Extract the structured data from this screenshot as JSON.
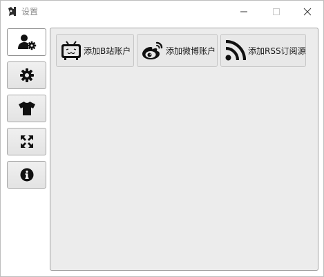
{
  "window": {
    "title": "设置",
    "controls": [
      "minimize-icon",
      "maximize-icon",
      "close-icon"
    ]
  },
  "sidebar": {
    "items": [
      {
        "icon": "user-gear-icon",
        "active": true
      },
      {
        "icon": "gear-icon",
        "active": false
      },
      {
        "icon": "tshirt-icon",
        "active": false
      },
      {
        "icon": "expand-arrows-icon",
        "active": false
      },
      {
        "icon": "info-icon",
        "active": false
      }
    ]
  },
  "accounts": {
    "buttons": [
      {
        "label": "添加B站账户",
        "icon": "bilibili-tv-icon"
      },
      {
        "label": "添加微博账户",
        "icon": "weibo-icon"
      },
      {
        "label": "添加RSS订阅源",
        "icon": "rss-icon"
      }
    ]
  }
}
